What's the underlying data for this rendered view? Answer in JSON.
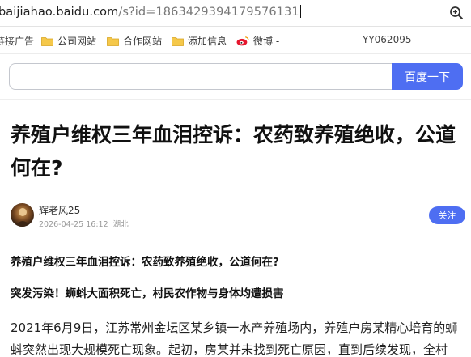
{
  "address_bar": {
    "url_host": "baijiahao.baidu.com",
    "url_path": "/s?id=1863429394179576131"
  },
  "bookmarks": [
    {
      "label": "链接广告"
    },
    {
      "label": "公司网站"
    },
    {
      "label": "合作网站"
    },
    {
      "label": "添加信息"
    },
    {
      "label": "微博 -"
    },
    {
      "label": "YY062095"
    }
  ],
  "search": {
    "value": "",
    "button_label": "百度一下"
  },
  "article": {
    "title": "养殖户维权三年血泪控诉：农药致养殖绝收，公道何在?",
    "author": {
      "name": "辉老风25",
      "date": "2026-04-25 16:12",
      "location": "湖北",
      "follow_label": "关注"
    },
    "headings": [
      "养殖户维权三年血泪控诉：农药致养殖绝收，公道何在?",
      "突发污染！蛳蚪大面积死亡，村民农作物与身体均遭损害"
    ],
    "paragraph_lines": [
      "2021年6月9日，江苏常州金坛区某乡镇一水产养殖场内，养殖户房某精心培育的蛳",
      "蚪突然出现大规模死亡现象。起初，房某并未找到死亡原因，直到后续发现，全村"
    ]
  },
  "colors": {
    "accent": "#4e6ef2",
    "folder": "#f5c84a"
  }
}
